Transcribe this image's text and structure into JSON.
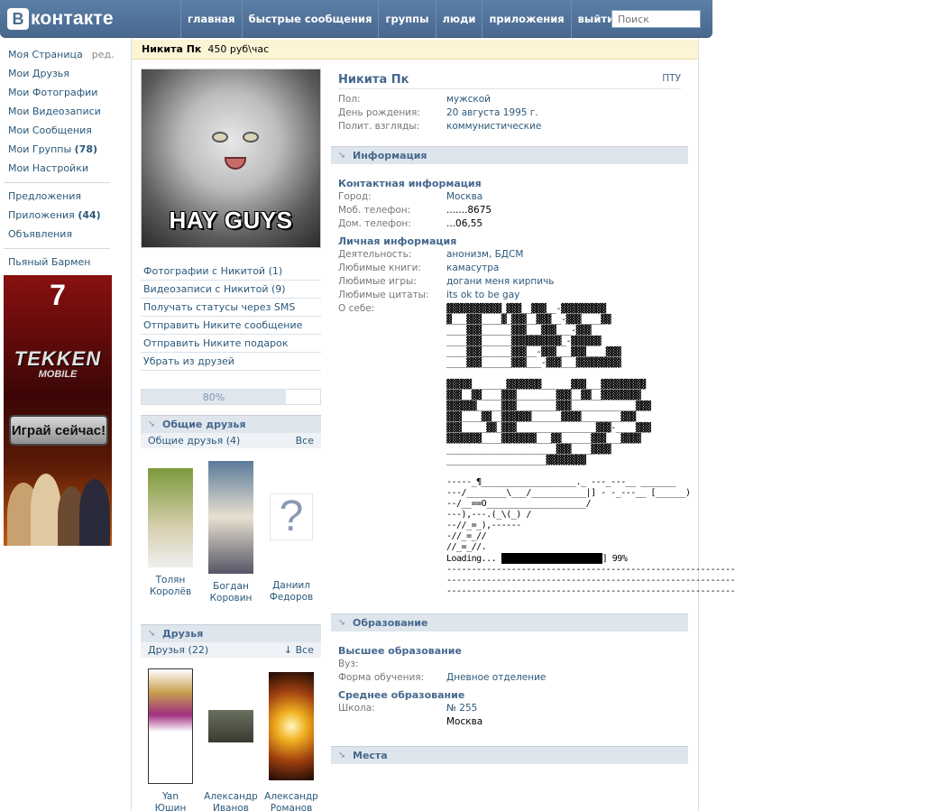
{
  "header": {
    "logo_letter": "В",
    "logo_text": "контакте",
    "nav": [
      "главная",
      "быстрые сообщения",
      "группы",
      "люди",
      "приложения",
      "выйти"
    ],
    "search_placeholder": "Поиск"
  },
  "leftmenu": {
    "items1": [
      {
        "label": "Моя Страница",
        "extra": "ред."
      },
      {
        "label": "Мои Друзья"
      },
      {
        "label": "Мои Фотографии"
      },
      {
        "label": "Мои Видеозаписи"
      },
      {
        "label": "Мои Сообщения"
      },
      {
        "label": "Мои Группы",
        "count": "(78)"
      },
      {
        "label": "Мои Настройки"
      }
    ],
    "items2": [
      {
        "label": "Предложения"
      },
      {
        "label": "Приложения",
        "count": "(44)"
      },
      {
        "label": "Объявления"
      }
    ],
    "items3": [
      {
        "label": "Пьяный Бармен"
      }
    ]
  },
  "ad": {
    "logo_main": "TEKKEN",
    "logo_sub": "MOBILE",
    "button": "Играй сейчас!",
    "seven": "7"
  },
  "status": {
    "name": "Никита Пк",
    "text": "450 руб\\час"
  },
  "avatar": {
    "caption": "HAY GUYS"
  },
  "actions": [
    "Фотографии с Никитой (1)",
    "Видеозаписи с Никитой (9)",
    "Получать статусы через SMS",
    "Отправить Никите сообщение",
    "Отправить Никите подарок",
    "Убрать из друзей"
  ],
  "rating": {
    "label": "80%",
    "value": 0.8
  },
  "common_friends": {
    "title": "Общие друзья",
    "subtitle": "Общие друзья (4)",
    "all": "Все",
    "people": [
      {
        "first": "Толян",
        "last": "Королёв"
      },
      {
        "first": "Богдан",
        "last": "Коровин"
      },
      {
        "first": "Даниил",
        "last": "Федоров"
      }
    ]
  },
  "friends": {
    "title": "Друзья",
    "subtitle": "Друзья (22)",
    "all": "↓ Все",
    "people": [
      {
        "first": "Yan",
        "last": "Юшин"
      },
      {
        "first": "Александр",
        "last": "Иванов"
      },
      {
        "first": "Александр",
        "last": "Романов"
      }
    ]
  },
  "profile": {
    "name": "Никита Пк",
    "tag": "ПТУ",
    "basic": [
      {
        "k": "Пол:",
        "v": "мужской"
      },
      {
        "k": "День рождения:",
        "v": "20 августа 1995 г."
      },
      {
        "k": "Полит. взгляды:",
        "v": "коммунистические"
      }
    ]
  },
  "info": {
    "title": "Информация",
    "contact_title": "Контактная информация",
    "contact": [
      {
        "k": "Город:",
        "v": "Москва",
        "link": true
      },
      {
        "k": "Моб. телефон:",
        "v": ".......8675",
        "link": false
      },
      {
        "k": "Дом. телефон:",
        "v": "...06,55",
        "link": false
      }
    ],
    "personal_title": "Личная информация",
    "personal": [
      {
        "k": "Деятельность:",
        "v": "анонизм, БДСМ"
      },
      {
        "k": "Любимые книги:",
        "v": "камасутра"
      },
      {
        "k": "Любимые игры:",
        "v": "догани меня кирпичь"
      },
      {
        "k": "Любимые цитаты:",
        "v": "its ok to be gay"
      }
    ],
    "about_label": "О себе:",
    "about_art1": "▓▓▓▓▓▓▓▓▓▓▓_▓▓▓__▓▓▓__-▓▓▓▓▓▓▓▓▓\n▓___▓▓▓____▓_▓▓▓__▓▓▓__-▓▓▓____▓▓\n____▓▓▓______▓▓▓___▓▓▓___-▓▓▓\n____▓▓▓______▓▓▓▓▓▓▓▓▓▓_-▓▓▓▓▓▓\n____▓▓▓______▓▓▓__-▓▓▓___▓▓▓____▓▓▓\n____▓▓▓______▓▓▓___-▓▓▓___▓▓▓▓▓▓▓▓▓",
    "about_art2": "▓▓▓▓▓_______▓▓▓▓▓▓▓______▓▓▓___▓▓▓▓▓▓▓▓▓\n▓▓▓__▓▓____▓▓▓________▓▓▓__▓▓__▓▓▓▓▓▓▓▓\n▓▓▓▓▓▓_____▓▓▓________▓▓▓_____________▓▓▓\n▓▓▓____▓▓__▓▓▓▓▓▓______▓▓▓▓________▓▓▓\n▓▓▓_____▓▓_▓▓▓________________▓▓▓-____▓▓▓\n▓▓▓▓▓▓▓____▓▓▓▓▓▓▓___▓▓______▓▓▓___▓▓▓▓\n______________________▓▓▓____▓▓▓▓\n____________________▓▓▓▓▓▓▓▓",
    "about_art3": "-----_¶___________________._ ---_---__ _______\n---/________\\___/___________|] - -_---__ [______)\n--/__==O____________________/\n---),---.(_\\(_) /\n--//_=_),------\n-//_=_//\n//_=_//.",
    "about_loading": "Loading...",
    "about_pct": "] 99%",
    "about_dashes": "----------------------------------------------------------\n----------------------------------------------------------\n----------------------------------------------------------"
  },
  "education": {
    "title": "Образование",
    "higher_title": "Высшее образование",
    "higher": [
      {
        "k": "Вуз:",
        "v": ""
      },
      {
        "k": "Форма обучения:",
        "v": "Дневное отделение"
      }
    ],
    "secondary_title": "Среднее образование",
    "school_label": "Школа:",
    "school": "№ 255",
    "school_city": "Москва"
  },
  "places": {
    "title": "Места"
  }
}
